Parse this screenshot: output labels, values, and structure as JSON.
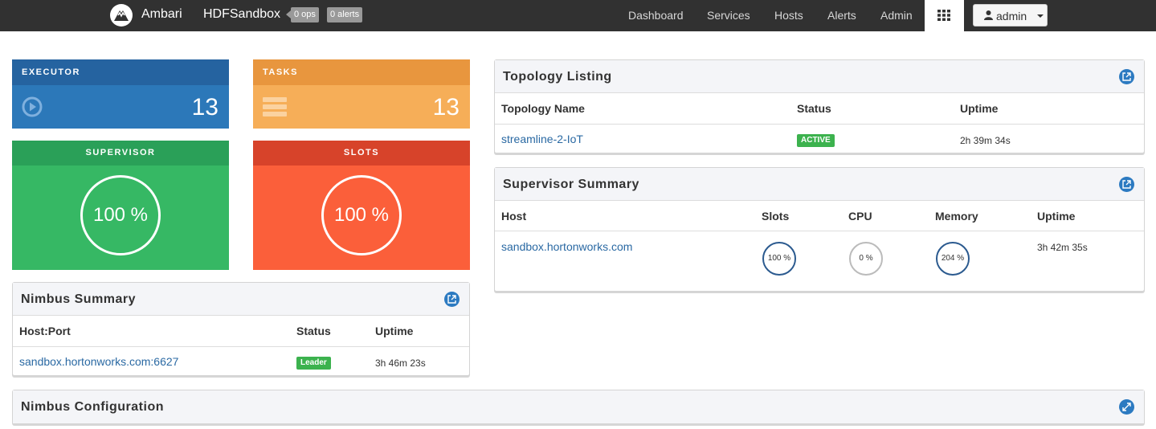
{
  "navbar": {
    "brand": "Ambari",
    "cluster": "HDFSandbox",
    "ops_badge": "0 ops",
    "alerts_badge": "0 alerts",
    "links": [
      "Dashboard",
      "Services",
      "Hosts",
      "Alerts",
      "Admin"
    ],
    "user": "admin"
  },
  "tiles": {
    "executor": {
      "title": "EXECUTOR",
      "count": "13",
      "icon": "play-circle-icon"
    },
    "tasks": {
      "title": "TASKS",
      "count": "13",
      "icon": "server-stack-icon"
    },
    "supervisor": {
      "title": "SUPERVISOR",
      "value": "100 %"
    },
    "slots": {
      "title": "SLOTS",
      "value": "100 %"
    }
  },
  "nimbus_summary": {
    "title": "Nimbus Summary",
    "headers": [
      "Host:Port",
      "Status",
      "Uptime"
    ],
    "rows": [
      {
        "host": "sandbox.hortonworks.com:6627",
        "status": "Leader",
        "uptime": "3h 46m 23s"
      }
    ]
  },
  "topology_listing": {
    "title": "Topology Listing",
    "headers": [
      "Topology Name",
      "Status",
      "Uptime"
    ],
    "rows": [
      {
        "name": "streamline-2-IoT",
        "status": "ACTIVE",
        "uptime": "2h 39m 34s"
      }
    ]
  },
  "supervisor_summary": {
    "title": "Supervisor Summary",
    "headers": [
      "Host",
      "Slots",
      "CPU",
      "Memory",
      "Uptime"
    ],
    "rows": [
      {
        "host": "sandbox.hortonworks.com",
        "slots": "100 %",
        "cpu": "0 %",
        "memory": "204 %",
        "uptime": "3h 42m 35s"
      }
    ]
  },
  "nimbus_configuration": {
    "title": "Nimbus Configuration"
  },
  "colors": {
    "navbar": "#313131",
    "executor": "#2c78b9",
    "tasks": "#f6ae58",
    "supervisor": "#36b864",
    "slots": "#fb5f3a",
    "link": "#2a69a3",
    "status_green": "#3cb24e"
  }
}
